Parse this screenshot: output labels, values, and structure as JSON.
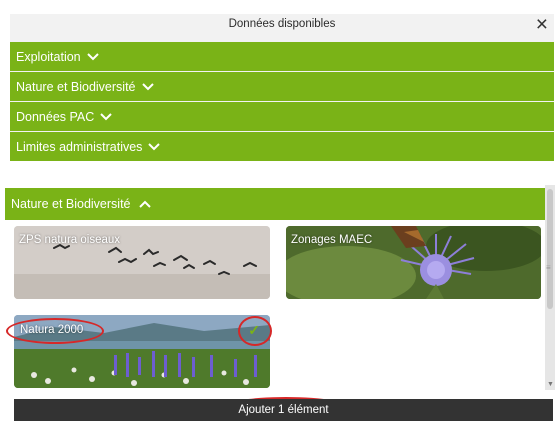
{
  "top_panel": {
    "title": "Données disponibles",
    "close_label": "×",
    "items": [
      {
        "label": "Exploitation"
      },
      {
        "label": "Nature et Biodiversité"
      },
      {
        "label": "Données PAC"
      },
      {
        "label": "Limites administratives"
      }
    ]
  },
  "bottom_panel": {
    "expanded_label": "Nature et Biodiversité",
    "cards": [
      {
        "label": "ZPS natura oiseaux"
      },
      {
        "label": "Zonages MAEC"
      },
      {
        "label": "Natura 2000",
        "selected": true
      }
    ],
    "add_button": "Ajouter 1 élément"
  },
  "colors": {
    "accent_green": "#7ab317",
    "button_dark": "#333333",
    "highlight_red": "#d62828"
  },
  "icons": {
    "close": "close-icon",
    "chevron_down": "chevron-down-icon",
    "chevron_up": "chevron-up-icon",
    "check": "check-icon"
  }
}
